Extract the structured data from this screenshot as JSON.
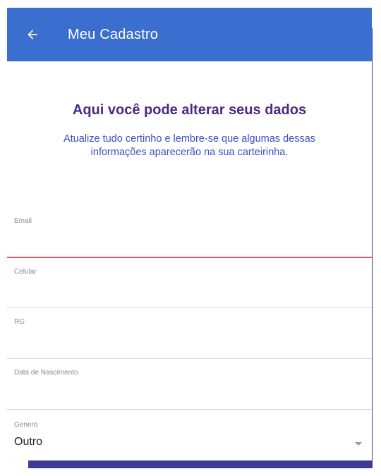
{
  "header": {
    "title": "Meu Cadastro",
    "back_icon": "arrow-left-icon"
  },
  "intro": {
    "title": "Aqui você pode alterar seus dados",
    "subtitle": "Atualize tudo certinho e lembre-se que algumas dessas informações aparecerão na sua carteirinha."
  },
  "form": {
    "email": {
      "label": "Email",
      "value": ""
    },
    "celular": {
      "label": "Celular",
      "value": ""
    },
    "rg": {
      "label": "RG",
      "value": ""
    },
    "nascimento": {
      "label": "Data de Nascimento",
      "value": ""
    },
    "genero": {
      "label": "Genero",
      "value": "Outro",
      "icon": "dropdown-caret-icon"
    }
  },
  "colors": {
    "appbar": "#3a6fd0",
    "backdrop": "#3d3a92",
    "title": "#4a2a82",
    "subtitle": "#3a4fc4",
    "active_underline": "#e15a5f"
  }
}
